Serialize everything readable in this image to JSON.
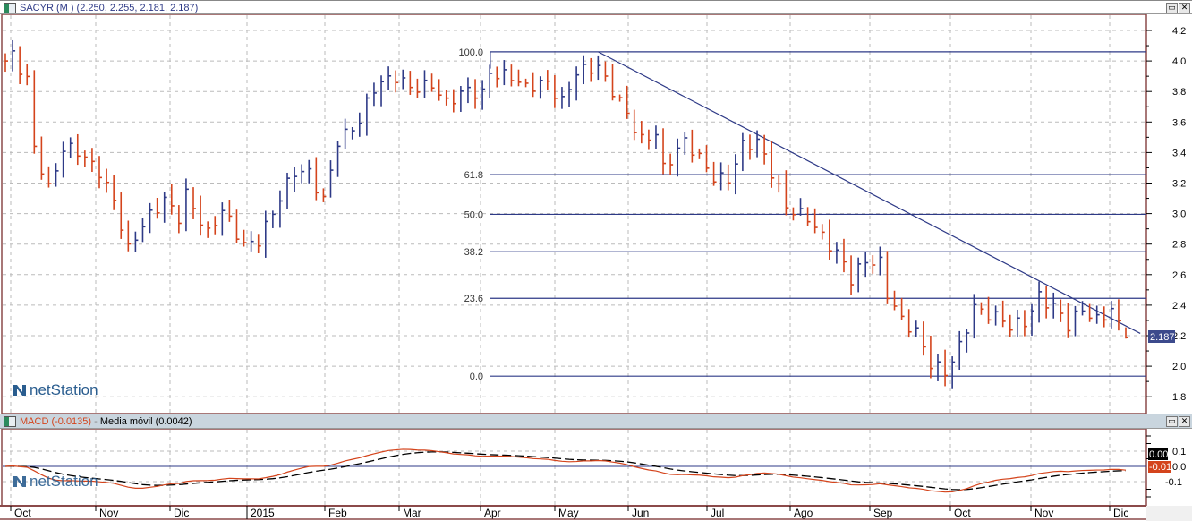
{
  "main_panel": {
    "title": "SACYR (M ) (2.250, 2.255, 2.181, 2.187)",
    "last_price_label": "2.187",
    "watermark": "netStation"
  },
  "macd_panel": {
    "macd_label": "MACD (-0.0135)",
    "separator": " - ",
    "signal_label": "Media móvil (0.0042)",
    "macd_value_box": "-0.01",
    "signal_value_box": "0.00",
    "watermark": "netStation"
  },
  "window_buttons": {
    "restore": "▭",
    "close": "✕"
  },
  "colors": {
    "up": "#2e3a87",
    "down": "#d4441c",
    "line": "#2e3a87",
    "macd": "#d4441c",
    "signal": "#000000",
    "frame": "#8b4a4a"
  },
  "chart_data": [
    {
      "type": "ohlc",
      "title": "SACYR (M )",
      "ylim": [
        1.75,
        4.25
      ],
      "y_ticks": [
        "4.2",
        "4.0",
        "3.8",
        "3.6",
        "3.4",
        "3.2",
        "3.0",
        "2.8",
        "2.6",
        "2.4",
        "2.2",
        "2.0",
        "1.8"
      ],
      "x_labels": [
        "Oct",
        "Nov",
        "Dic",
        "2015",
        "Feb",
        "Mar",
        "Apr",
        "May",
        "Jun",
        "Jul",
        "Ago",
        "Sep",
        "Oct",
        "Nov",
        "Dic"
      ],
      "bar_count": 156,
      "close_path": [
        [
          0,
          4.0
        ],
        [
          1,
          4.05
        ],
        [
          3,
          3.9
        ],
        [
          4,
          3.45
        ],
        [
          6,
          3.15
        ],
        [
          8,
          3.4
        ],
        [
          10,
          3.4
        ],
        [
          13,
          3.3
        ],
        [
          15,
          3.1
        ],
        [
          17,
          2.75
        ],
        [
          19,
          2.9
        ],
        [
          22,
          3.1
        ],
        [
          24,
          3.0
        ],
        [
          25,
          3.15
        ],
        [
          28,
          2.85
        ],
        [
          30,
          3.0
        ],
        [
          33,
          2.8
        ],
        [
          35,
          2.85
        ],
        [
          38,
          3.1
        ],
        [
          40,
          3.25
        ],
        [
          42,
          3.25
        ],
        [
          44,
          3.1
        ],
        [
          46,
          3.5
        ],
        [
          49,
          3.6
        ],
        [
          51,
          3.8
        ],
        [
          54,
          3.9
        ],
        [
          56,
          3.85
        ],
        [
          59,
          3.85
        ],
        [
          61,
          3.7
        ],
        [
          64,
          3.8
        ],
        [
          66,
          3.8
        ],
        [
          67,
          3.95
        ],
        [
          70,
          3.9
        ],
        [
          72,
          3.8
        ],
        [
          75,
          3.85
        ],
        [
          77,
          3.75
        ],
        [
          79,
          3.95
        ],
        [
          82,
          3.95
        ],
        [
          83,
          3.85
        ],
        [
          86,
          3.65
        ],
        [
          88,
          3.5
        ],
        [
          90,
          3.55
        ],
        [
          91,
          3.3
        ],
        [
          94,
          3.45
        ],
        [
          96,
          3.35
        ],
        [
          98,
          3.25
        ],
        [
          100,
          3.25
        ],
        [
          102,
          3.45
        ],
        [
          104,
          3.45
        ],
        [
          106,
          3.25
        ],
        [
          108,
          3.05
        ],
        [
          111,
          3.0
        ],
        [
          113,
          2.85
        ],
        [
          116,
          2.65
        ],
        [
          117,
          2.55
        ],
        [
          119,
          2.7
        ],
        [
          121,
          2.7
        ],
        [
          122,
          2.5
        ],
        [
          124,
          2.3
        ],
        [
          126,
          2.2
        ],
        [
          128,
          2.0
        ],
        [
          130,
          1.97
        ],
        [
          132,
          2.15
        ],
        [
          134,
          2.4
        ],
        [
          135,
          2.35
        ],
        [
          137,
          2.3
        ],
        [
          139,
          2.25
        ],
        [
          141,
          2.3
        ],
        [
          143,
          2.48
        ],
        [
          145,
          2.4
        ],
        [
          147,
          2.25
        ],
        [
          149,
          2.35
        ],
        [
          151,
          2.3
        ],
        [
          153,
          2.4
        ],
        [
          155,
          2.187
        ]
      ],
      "last": {
        "open": 2.25,
        "high": 2.255,
        "low": 2.181,
        "close": 2.187
      },
      "fibonacci": [
        {
          "label": "100.0",
          "price": 4.06
        },
        {
          "label": "61.8",
          "price": 3.255
        },
        {
          "label": "50.0",
          "price": 2.995
        },
        {
          "label": "38.2",
          "price": 2.75
        },
        {
          "label": "23.6",
          "price": 2.445
        },
        {
          "label": "0.0",
          "price": 1.935
        }
      ],
      "trendline": {
        "from": [
          82,
          4.06
        ],
        "to": [
          157,
          2.215
        ]
      }
    },
    {
      "type": "line",
      "title": "MACD",
      "series": [
        {
          "name": "MACD",
          "last": -0.0135
        },
        {
          "name": "Media móvil",
          "last": 0.0042
        }
      ],
      "ylim": [
        -0.25,
        0.2
      ],
      "y_ticks": [
        "0.1",
        "0.0",
        "-0.1"
      ]
    }
  ]
}
